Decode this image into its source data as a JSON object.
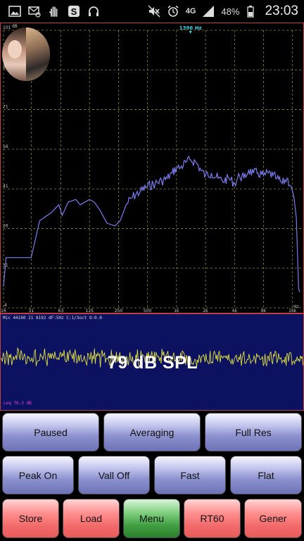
{
  "status_bar": {
    "left_icons": [
      "gallery-icon",
      "email-icon",
      "hand-icon",
      "s-badge-icon",
      "headphones-icon"
    ],
    "right_icons": [
      "mute-icon",
      "alarm-icon",
      "signal-icon",
      "battery-icon"
    ],
    "network": "4G",
    "battery": "48%",
    "time": "23:03"
  },
  "spectrum": {
    "peak_freq": "1396 Hz",
    "y_unit": "dB",
    "y_ticks": [
      "101",
      "86",
      "71",
      "56",
      "41",
      "26",
      "11",
      "-4"
    ],
    "x_ticks": [
      "16",
      "31",
      "63",
      "125",
      "250",
      "500",
      "1k",
      "2k",
      "4k",
      "8k",
      "16k"
    ],
    "x_unit": "Hz",
    "colors": {
      "grid": "#8a8a2a",
      "trace": "#7a7df0",
      "peak_marker": "#30d0e0",
      "border": "#c04040"
    }
  },
  "chart_data": {
    "type": "line",
    "title": "",
    "xlabel": "Hz",
    "ylabel": "dB",
    "x_scale": "log",
    "xlim": [
      16,
      20000
    ],
    "ylim": [
      -4,
      101
    ],
    "grid": true,
    "series": [
      {
        "x": [
          16,
          17,
          31,
          38,
          50,
          60,
          65,
          75,
          90,
          100,
          125,
          140,
          160,
          190,
          230,
          260,
          300,
          350,
          420,
          500,
          600,
          700,
          800,
          900,
          1000,
          1100,
          1250,
          1400,
          1600,
          1800,
          2000,
          2300,
          2700,
          3000,
          3500,
          4000,
          4500,
          5000,
          5600,
          6300,
          7000,
          8000,
          9000,
          10000,
          11000,
          12500,
          14000,
          15500,
          16500,
          17500,
          18500,
          19000
        ],
        "values": [
          4,
          15,
          15,
          29,
          32,
          35,
          31,
          36,
          37,
          35,
          37,
          36,
          33,
          28,
          27,
          29,
          35,
          38,
          40,
          42,
          43,
          44,
          45,
          47,
          49,
          49,
          51,
          52,
          51,
          48,
          46,
          47,
          45,
          44,
          45,
          43,
          46,
          45,
          48,
          47,
          47,
          46,
          47,
          46,
          45,
          43,
          45,
          42,
          38,
          30,
          3,
          2
        ]
      }
    ]
  },
  "wave": {
    "info": "Mic 44100 21 8192 dF:5Hz C:1/3oct O:0.0",
    "spl": "79 dB SPL",
    "leq": "Leq 76.3 dB",
    "colors": {
      "background": "#0c1260",
      "wave": "#e0e040"
    }
  },
  "buttons": {
    "row1": [
      "Paused",
      "Averaging",
      "Full Res"
    ],
    "row2": [
      "Peak On",
      "Vall Off",
      "Fast",
      "Flat"
    ],
    "row3": [
      "Store",
      "Load",
      "Menu",
      "RT60",
      "Gener"
    ]
  }
}
